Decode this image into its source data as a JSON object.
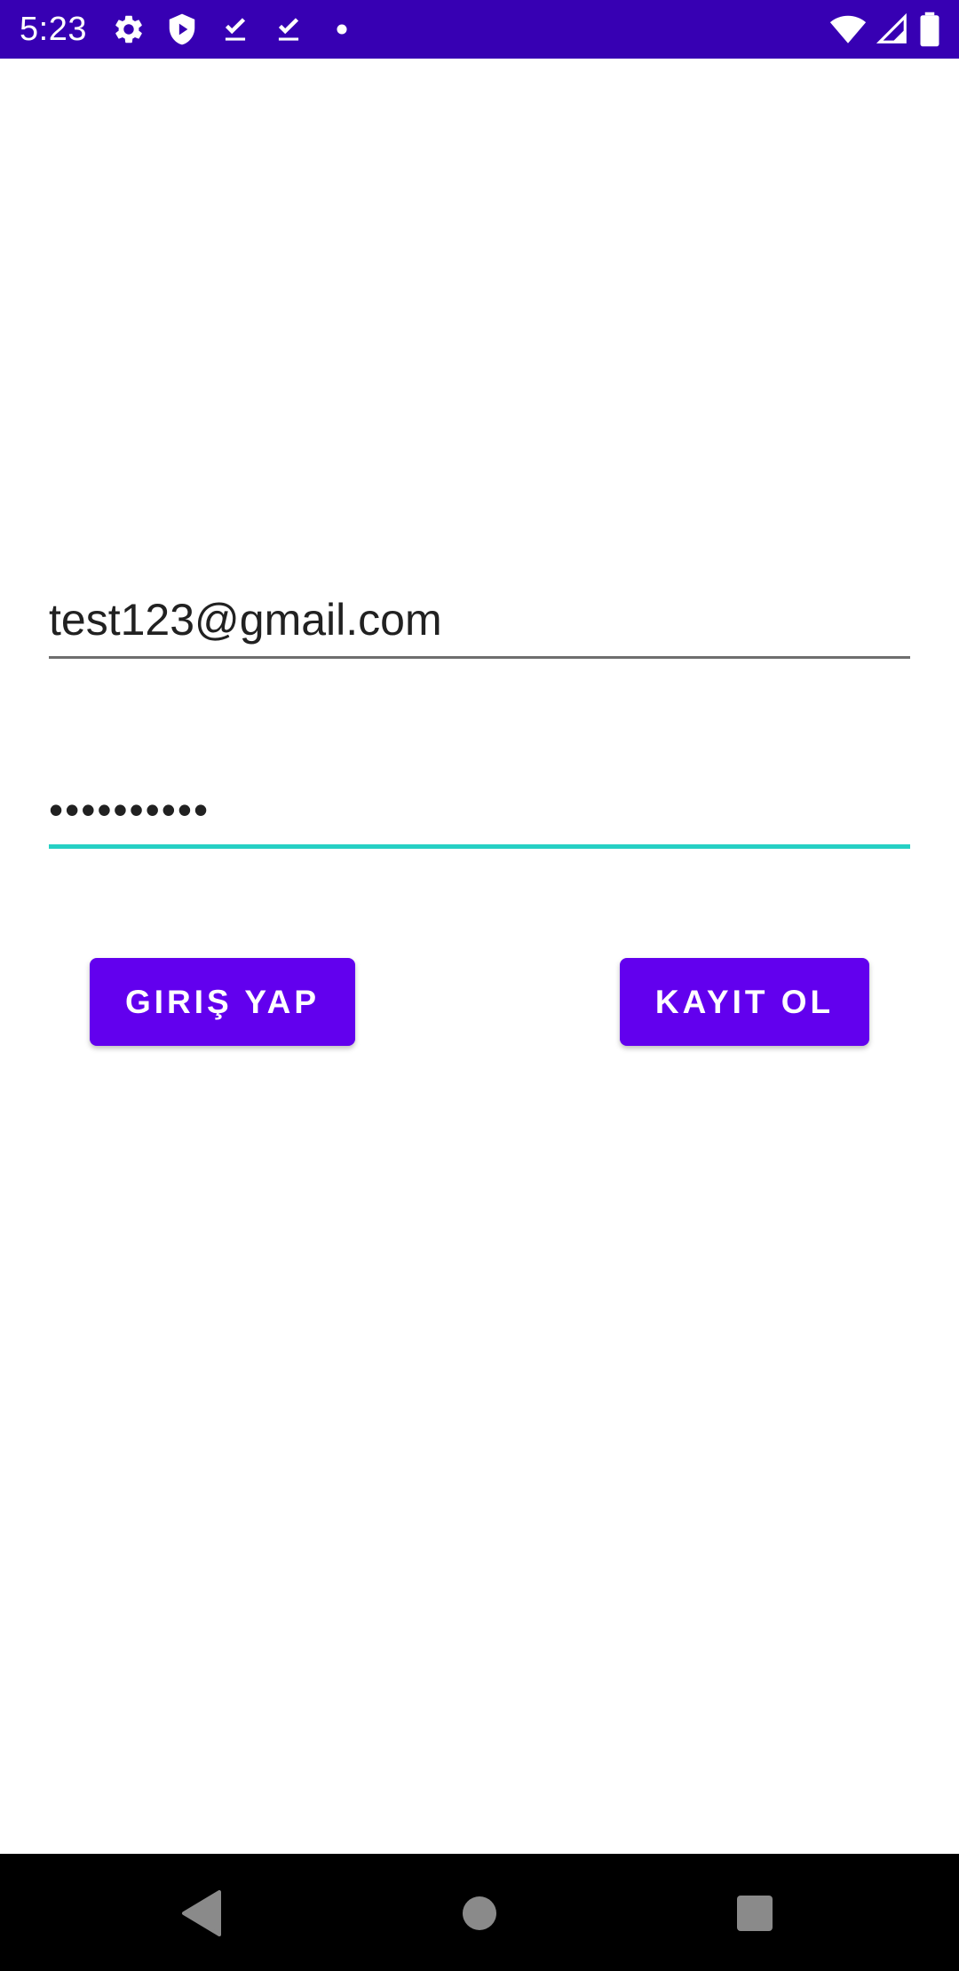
{
  "status_bar": {
    "time": "5:23",
    "background_color": "#3700b3",
    "left_icons": [
      "settings-gear-icon",
      "shield-icon",
      "download-done-icon",
      "download-done-icon",
      "dot-icon"
    ],
    "right_icons": [
      "wifi-icon",
      "cell-signal-icon",
      "battery-icon"
    ]
  },
  "login_form": {
    "email": {
      "value": "test123@gmail.com"
    },
    "password": {
      "masked_value": "••••••••••",
      "focused": true,
      "focus_color": "#26d0c4"
    },
    "login_button_label": "GIRIŞ YAP",
    "register_button_label": "KAYIT OL",
    "button_color": "#6200ee"
  },
  "nav_bar": {
    "buttons": [
      "back-icon",
      "home-icon",
      "recents-icon"
    ]
  }
}
